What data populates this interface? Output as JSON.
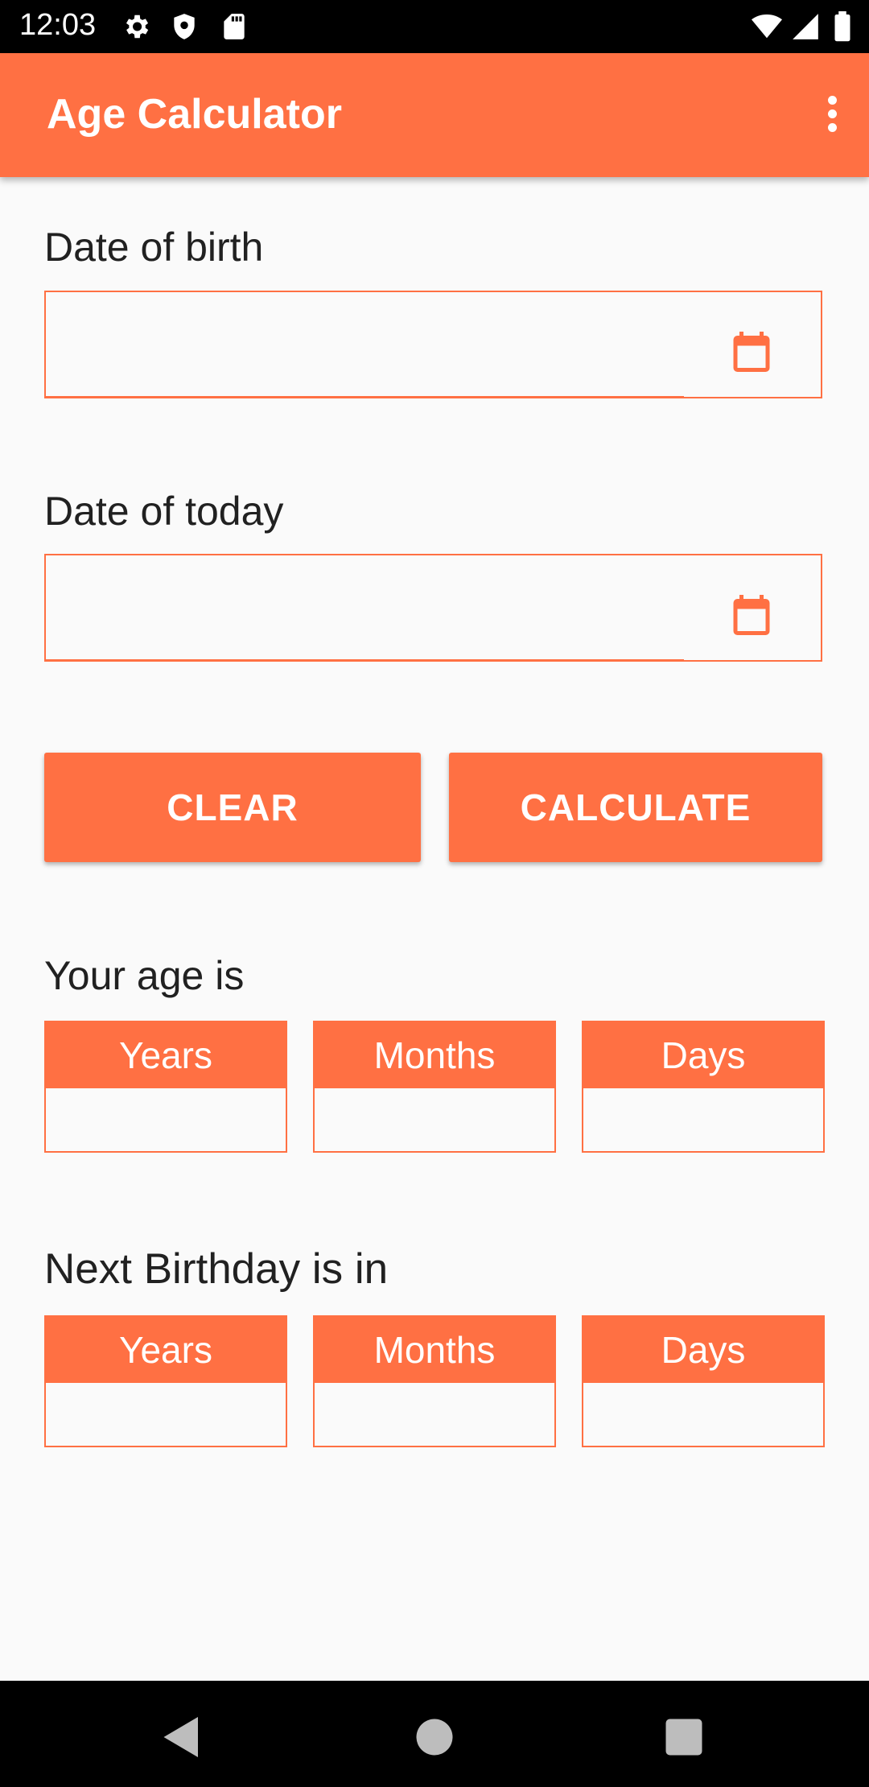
{
  "status_bar": {
    "time": "12:03",
    "left_icons": [
      "gear-icon",
      "shield-icon",
      "sd-card-icon"
    ],
    "right_icons": [
      "wifi-icon",
      "signal-icon",
      "battery-icon"
    ]
  },
  "app_bar": {
    "title": "Age Calculator",
    "menu_icon": "overflow-menu-icon",
    "color": "#ff7043"
  },
  "form": {
    "dob_label": "Date of birth",
    "dob_value": "",
    "today_label": "Date of today",
    "today_value": "",
    "calendar_icon": "calendar-icon"
  },
  "buttons": {
    "clear": "CLEAR",
    "calculate": "CALCULATE"
  },
  "age": {
    "title": "Your age is",
    "boxes": [
      {
        "label": "Years",
        "value": ""
      },
      {
        "label": "Months",
        "value": ""
      },
      {
        "label": "Days",
        "value": ""
      }
    ]
  },
  "next_birthday": {
    "title": "Next Birthday is in",
    "boxes": [
      {
        "label": "Years",
        "value": ""
      },
      {
        "label": "Months",
        "value": ""
      },
      {
        "label": "Days",
        "value": ""
      }
    ]
  },
  "nav_bar": {
    "icons": [
      "back-icon",
      "home-icon",
      "recents-icon"
    ]
  },
  "colors": {
    "accent": "#ff7043",
    "background": "#fafafa",
    "text": "#212121"
  }
}
